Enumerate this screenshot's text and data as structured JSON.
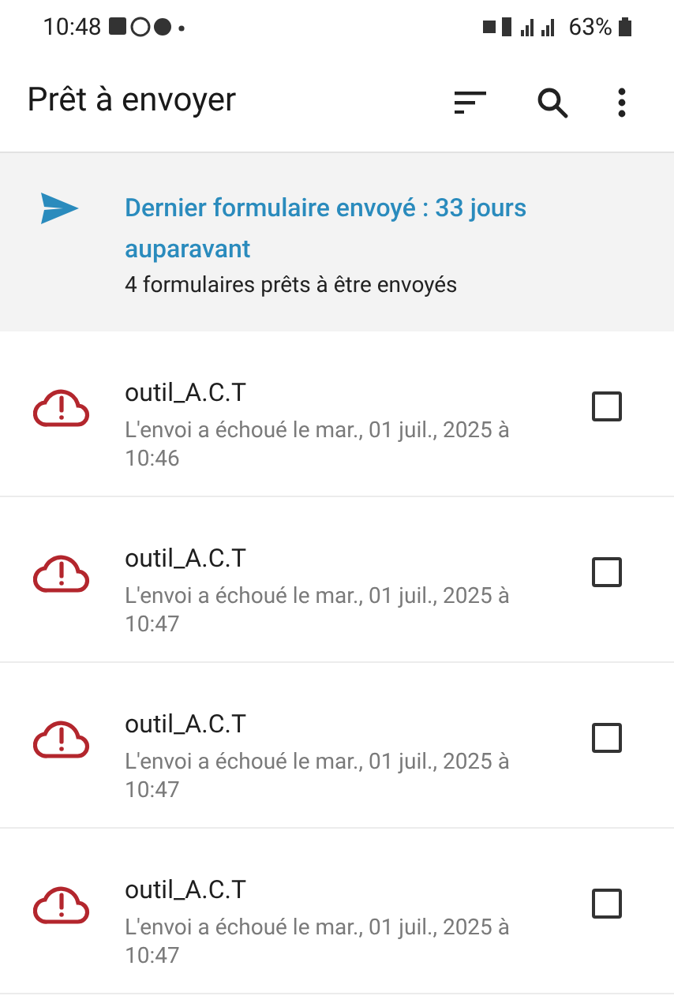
{
  "status_bar": {
    "time": "10:48",
    "battery": "63%"
  },
  "app_bar": {
    "title": "Prêt à envoyer"
  },
  "banner": {
    "title": "Dernier formulaire envoyé : 33 jours auparavant",
    "subtitle": "4 formulaires prêts à être envoyés"
  },
  "forms": [
    {
      "name": "outil_A.C.T",
      "status": "L'envoi a échoué le mar., 01 juil., 2025 à 10:46",
      "checked": false
    },
    {
      "name": "outil_A.C.T",
      "status": "L'envoi a échoué le mar., 01 juil., 2025 à 10:47",
      "checked": false
    },
    {
      "name": "outil_A.C.T",
      "status": "L'envoi a échoué le mar., 01 juil., 2025 à 10:47",
      "checked": false
    },
    {
      "name": "outil_A.C.T",
      "status": "L'envoi a échoué le mar., 01 juil., 2025 à 10:47",
      "checked": false
    }
  ]
}
